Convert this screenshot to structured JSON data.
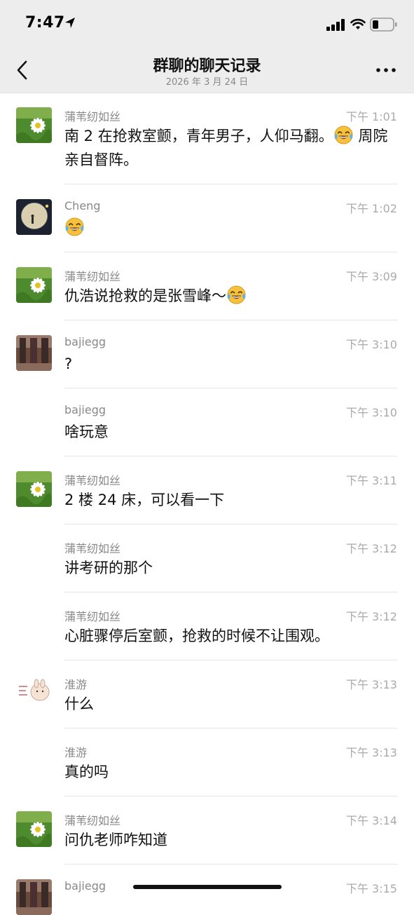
{
  "status_bar": {
    "time": "7:47"
  },
  "nav": {
    "title": "群聊的聊天记录",
    "subtitle": "2026 年 3 月 24 日"
  },
  "messages": [
    {
      "sender": "蒲苇纫如丝",
      "time": "下午 1:01",
      "text_a": "南 2 在抢救室颤，青年男子，人仰马翻。",
      "text_b": " 周院亲自督阵。",
      "emoji": "laughing-crying-emoji"
    },
    {
      "sender": "Cheng",
      "time": "下午 1:02",
      "emoji": "laughing-crying-emoji"
    },
    {
      "sender": "蒲苇纫如丝",
      "time": "下午 3:09",
      "text_a": "仇浩说抢救的是张雪峰～",
      "emoji": "laughing-crying-emoji"
    },
    {
      "sender": "bajiegg",
      "time": "下午 3:10",
      "text": "?"
    },
    {
      "sender": "bajiegg",
      "time": "下午 3:10",
      "text": "啥玩意"
    },
    {
      "sender": "蒲苇纫如丝",
      "time": "下午 3:11",
      "text": "2 楼 24 床，可以看一下"
    },
    {
      "sender": "蒲苇纫如丝",
      "time": "下午 3:12",
      "text": "讲考研的那个"
    },
    {
      "sender": "蒲苇纫如丝",
      "time": "下午 3:12",
      "text": "心脏骤停后室颤，抢救的时候不让围观。"
    },
    {
      "sender": "淮游",
      "time": "下午 3:13",
      "text": "什么"
    },
    {
      "sender": "淮游",
      "time": "下午 3:13",
      "text": "真的吗"
    },
    {
      "sender": "蒲苇纫如丝",
      "time": "下午 3:14",
      "text": "问仇老师咋知道"
    },
    {
      "sender": "bajiegg",
      "time": "下午 3:15"
    }
  ]
}
